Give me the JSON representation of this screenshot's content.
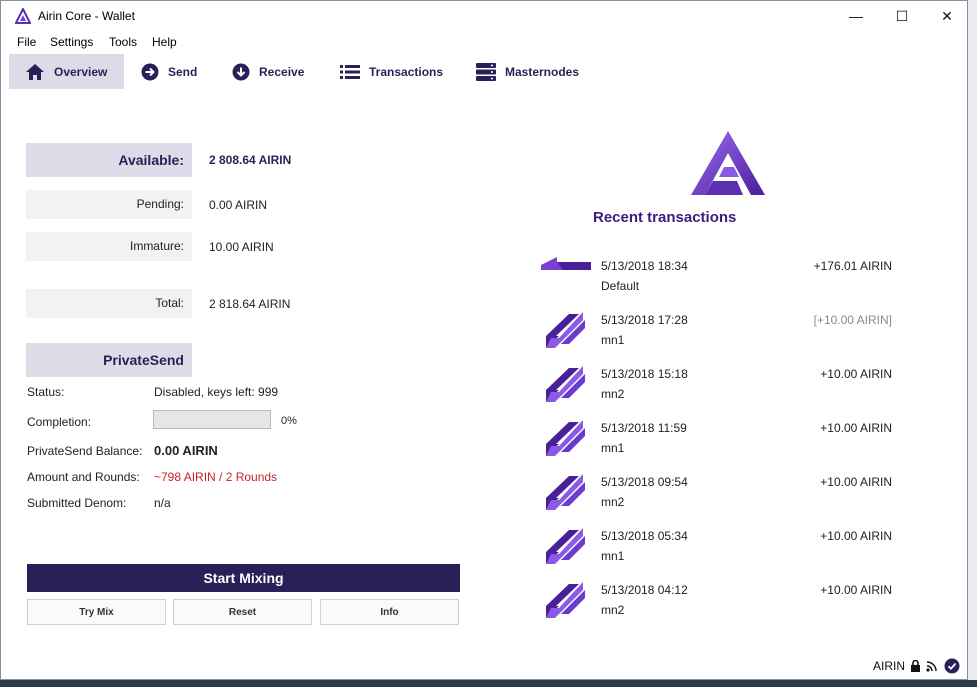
{
  "window": {
    "title": "Airin Core - Wallet",
    "controls": {
      "minimize": "—",
      "maximize": "☐",
      "close": "✕"
    }
  },
  "menu": [
    "File",
    "Settings",
    "Tools",
    "Help"
  ],
  "toolbar": {
    "overview": "Overview",
    "send": "Send",
    "receive": "Receive",
    "transactions": "Transactions",
    "masternodes": "Masternodes",
    "active": "overview"
  },
  "balances": {
    "available_label": "Available:",
    "available": "2 808.64 AIRIN",
    "pending_label": "Pending:",
    "pending": "0.00 AIRIN",
    "immature_label": "Immature:",
    "immature": "10.00 AIRIN",
    "total_label": "Total:",
    "total": "2 818.64 AIRIN"
  },
  "privatesend": {
    "header": "PrivateSend",
    "status_label": "Status:",
    "status": "Disabled, keys left: 999",
    "completion_label": "Completion:",
    "completion_pct": "0%",
    "completion": 0,
    "balance_label": "PrivateSend Balance:",
    "balance": "0.00 AIRIN",
    "rounds_label": "Amount and Rounds:",
    "rounds": "~798 AIRIN / 2 Rounds",
    "denom_label": "Submitted Denom:",
    "denom": "n/a",
    "start_button": "Start Mixing",
    "try_mix": "Try Mix",
    "reset": "Reset",
    "info": "Info"
  },
  "recent": {
    "title": "Recent transactions",
    "items": [
      {
        "date": "5/13/2018 18:34",
        "label": "Default",
        "amount": "+176.01 AIRIN",
        "type": "received"
      },
      {
        "date": "5/13/2018 17:28",
        "label": "mn1",
        "amount": "[+10.00 AIRIN]",
        "type": "mint"
      },
      {
        "date": "5/13/2018 15:18",
        "label": "mn2",
        "amount": "+10.00 AIRIN",
        "type": "mint"
      },
      {
        "date": "5/13/2018 11:59",
        "label": "mn1",
        "amount": "+10.00 AIRIN",
        "type": "mint"
      },
      {
        "date": "5/13/2018 09:54",
        "label": "mn2",
        "amount": "+10.00 AIRIN",
        "type": "mint"
      },
      {
        "date": "5/13/2018 05:34",
        "label": "mn1",
        "amount": "+10.00 AIRIN",
        "type": "mint"
      },
      {
        "date": "5/13/2018 04:12",
        "label": "mn2",
        "amount": "+10.00 AIRIN",
        "type": "mint"
      }
    ]
  },
  "statusbar": {
    "unit": "AIRIN"
  },
  "colors": {
    "brand": "#2b1f57",
    "accent": "#7b3fd6",
    "highlight": "#dcdbe8",
    "warning": "#cc2222"
  },
  "icons": [
    "home-icon",
    "send-icon",
    "receive-icon",
    "transactions-icon",
    "masternodes-icon",
    "lock-icon",
    "network-icon",
    "synced-icon"
  ]
}
